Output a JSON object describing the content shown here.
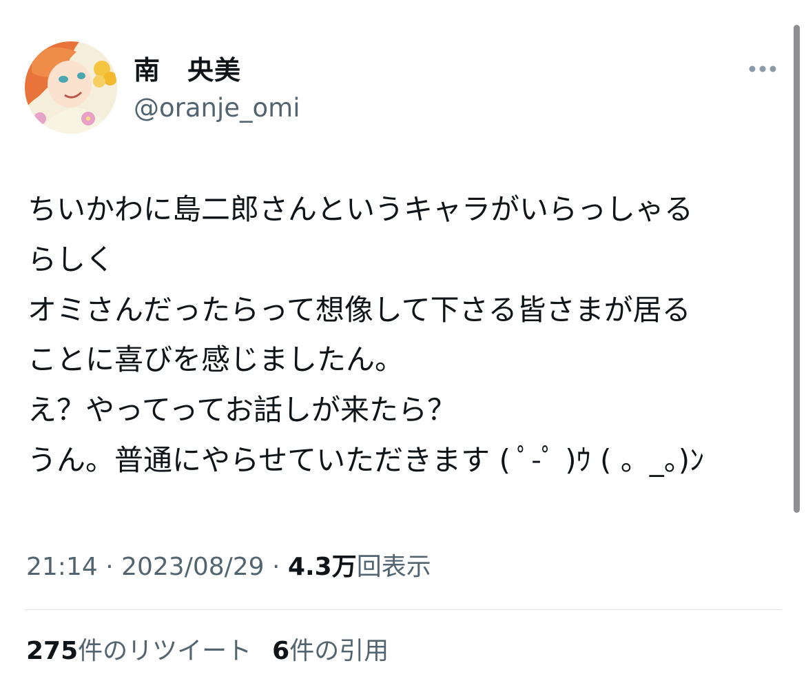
{
  "author": {
    "display_name": "南　央美",
    "handle": "@oranje_omi"
  },
  "tweet": {
    "lines": [
      "ちいかわに島二郎さんというキャラがいらっしゃる",
      "らしく",
      "オミさんだったらって想像して下さる皆さまが居る",
      "ことに喜びを感じましたん。",
      "え？やってってお話しが来たら？",
      "うん。普通にやらせていただきます ( ﾟ-ﾟ )ｳ ( 。_。)ﾝ"
    ]
  },
  "meta": {
    "time": "21:14",
    "separator": " · ",
    "date": "2023/08/29",
    "views_count": "4.3万",
    "views_label": "回表示"
  },
  "stats": {
    "retweets_count": "275",
    "retweets_label": "件のリツイート",
    "quotes_count": "6",
    "quotes_label": "件の引用"
  },
  "icons": {
    "more": "more-dots-icon",
    "avatar": "profile-avatar"
  },
  "colors": {
    "text": "#0f1419",
    "secondary": "#536471",
    "divider": "#dfe3e7"
  }
}
